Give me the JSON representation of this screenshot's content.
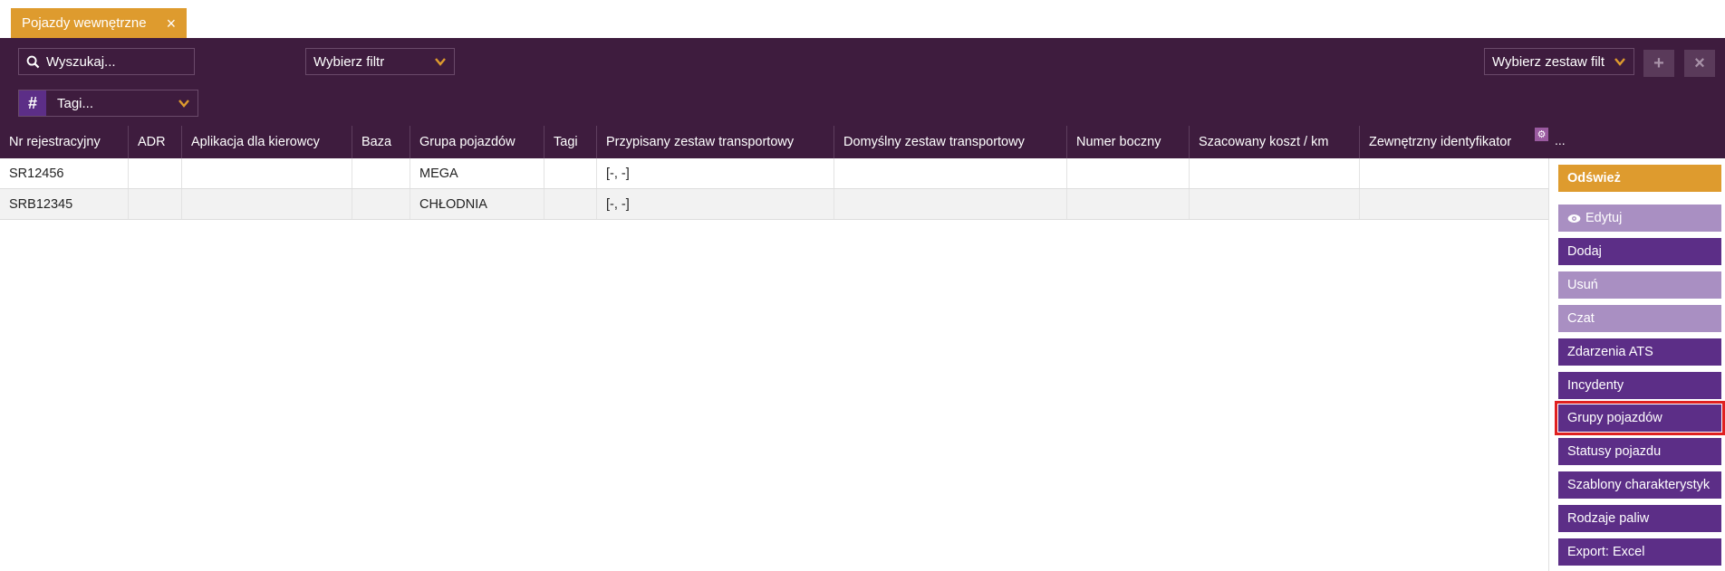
{
  "tab": {
    "label": "Pojazdy wewnętrzne",
    "close": "×"
  },
  "toolbar": {
    "search_placeholder": "Wyszukaj...",
    "filter_label": "Wybierz filtr",
    "filter_set_label": "Wybierz zestaw filt",
    "tags_label": "Tagi...",
    "add_symbol": "+",
    "remove_symbol": "×",
    "hash_symbol": "#"
  },
  "table": {
    "columns": [
      "Nr rejestracyjny",
      "ADR",
      "Aplikacja dla kierowcy",
      "Baza",
      "Grupa pojazdów",
      "Tagi",
      "Przypisany zestaw transportowy",
      "Domyślny zestaw transportowy",
      "Numer boczny",
      "Szacowany koszt / km",
      "Zewnętrzny identyfikator"
    ],
    "more": "...",
    "rows": [
      [
        "SR12456",
        "",
        "",
        "",
        "MEGA",
        "",
        "[-, -]",
        "",
        "",
        "",
        ""
      ],
      [
        "SRB12345",
        "",
        "",
        "",
        "CHŁODNIA",
        "",
        "[-, -]",
        "",
        "",
        "",
        ""
      ]
    ]
  },
  "sidebar": {
    "refresh": "Odśwież",
    "items": [
      {
        "label": "Edytuj",
        "enabled": false,
        "icon": "eye-icon"
      },
      {
        "label": "Dodaj",
        "enabled": true
      },
      {
        "label": "Usuń",
        "enabled": false
      },
      {
        "label": "Czat",
        "enabled": false
      },
      {
        "label": "Zdarzenia ATS",
        "enabled": true
      },
      {
        "label": "Incydenty",
        "enabled": true
      },
      {
        "label": "Grupy pojazdów",
        "enabled": true
      },
      {
        "label": "Statusy pojazdu",
        "enabled": true
      },
      {
        "label": "Szablony charakterystyk",
        "enabled": true
      },
      {
        "label": "Rodzaje paliw",
        "enabled": true
      },
      {
        "label": "Export: Excel",
        "enabled": true
      }
    ]
  },
  "colors": {
    "toolbar_bg": "#3e1c3e",
    "accent_orange": "#de9b2e",
    "button_purple": "#5c2e87",
    "button_disabled": "#a98fc2",
    "highlight": "#e02020"
  }
}
